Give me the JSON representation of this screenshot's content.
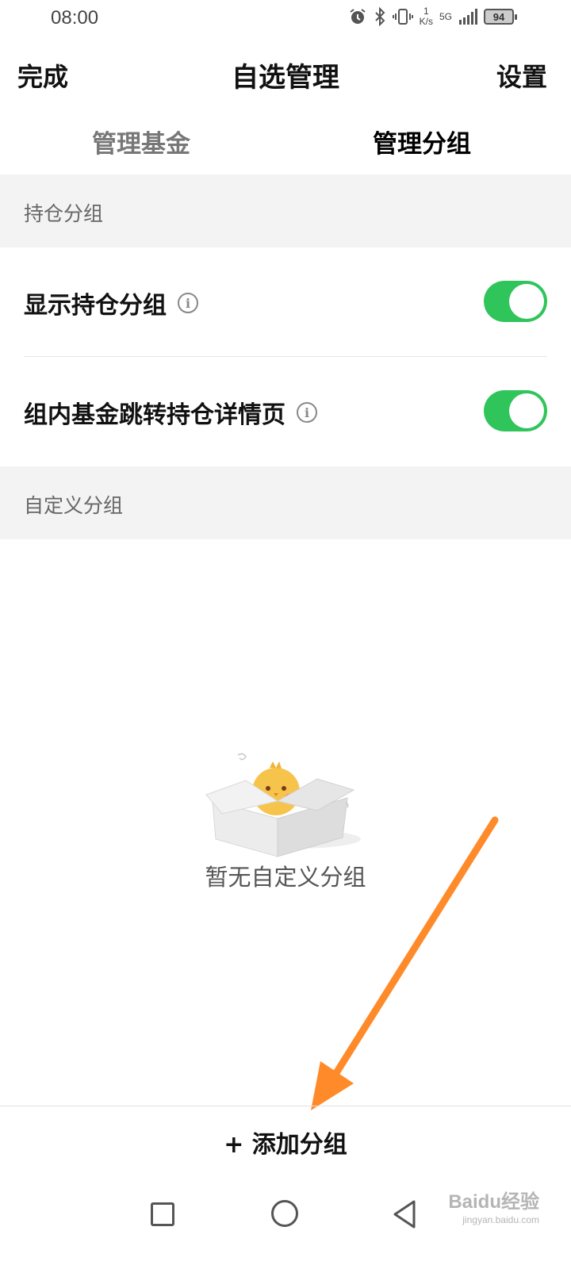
{
  "status_bar": {
    "time": "08:00",
    "speed_value": "1",
    "speed_unit": "K/s",
    "network": "5G",
    "battery": "94",
    "icons": [
      "alarm-icon",
      "bluetooth-icon",
      "vibrate-icon",
      "signal-icon",
      "battery-icon"
    ]
  },
  "header": {
    "done_label": "完成",
    "title": "自选管理",
    "settings_label": "设置"
  },
  "tabs": [
    {
      "label": "管理基金",
      "active": false
    },
    {
      "label": "管理分组",
      "active": true
    }
  ],
  "holding_section": {
    "title": "持仓分组",
    "rows": [
      {
        "label": "显示持仓分组",
        "toggle_on": true
      },
      {
        "label": "组内基金跳转持仓详情页",
        "toggle_on": true
      }
    ]
  },
  "custom_section": {
    "title": "自定义分组",
    "empty_text": "暂无自定义分组"
  },
  "footer": {
    "add_group_label": "+ 添加分组"
  },
  "watermark": {
    "text": "Baidu经验",
    "sub": "jingyan.baidu.com"
  },
  "colors": {
    "toggle_on": "#2fc55a",
    "section_bg": "#f3f3f3",
    "annotation_arrow": "#ff8a2a"
  }
}
